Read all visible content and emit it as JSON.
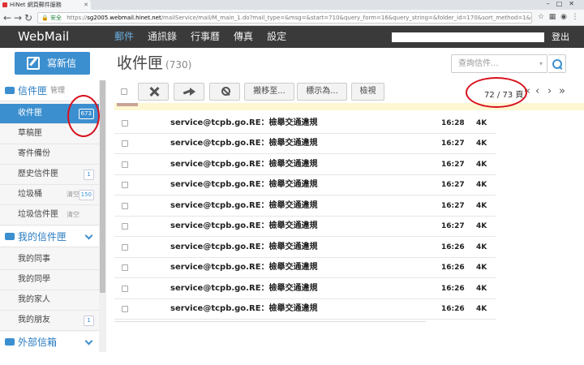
{
  "browser": {
    "tab_title": "HiNet 網頁郵件服務",
    "security_label": "安全",
    "url_scheme": "https://",
    "url_domain": "sg2005.webmail.hinet.net",
    "url_path": "/mailService/mail/M_main_1.do?mail_type=&msg=&start=710&query_form=16&query_string=&folder_id=170&sort_method=1&sort..."
  },
  "header": {
    "logo": "WebMail",
    "nav": [
      "郵件",
      "通訊錄",
      "行事曆",
      "傳真",
      "設定"
    ],
    "active_nav": "郵件",
    "logout": "登出"
  },
  "compose": {
    "label": "寫新信"
  },
  "main": {
    "title": "收件匣",
    "count": "(730)",
    "search_placeholder": "查詢信件..."
  },
  "sidebar": {
    "sections": [
      {
        "title": "信件匣",
        "sub": "管理"
      },
      {
        "title": "我的信件匣"
      },
      {
        "title": "外部信箱"
      }
    ],
    "folders": [
      {
        "label": "收件匣",
        "badge": "673",
        "active": true
      },
      {
        "label": "草稿匣"
      },
      {
        "label": "寄件備份"
      },
      {
        "label": "歷史信件匣",
        "badge": "1"
      },
      {
        "label": "垃圾桶",
        "empty": "清空",
        "badge": "150"
      },
      {
        "label": "垃圾信件匣",
        "empty": "清空"
      }
    ],
    "my_folders": [
      {
        "label": "我的同事"
      },
      {
        "label": "我的同學"
      },
      {
        "label": "我的家人"
      },
      {
        "label": "我的朋友",
        "badge": "1"
      }
    ]
  },
  "toolbar": {
    "move_to": "搬移至...",
    "mark_as": "標示為...",
    "view": "檢視",
    "page_info": "72 / 73 頁"
  },
  "messages": [
    {
      "from": "service@tcpb.go...",
      "subject": "RE：檢舉交通違規",
      "time": "16:28",
      "size": "4K"
    },
    {
      "from": "service@tcpb.go...",
      "subject": "RE：檢舉交通違規",
      "time": "16:27",
      "size": "4K"
    },
    {
      "from": "service@tcpb.go...",
      "subject": "RE：檢舉交通違規",
      "time": "16:27",
      "size": "4K"
    },
    {
      "from": "service@tcpb.go...",
      "subject": "RE：檢舉交通違規",
      "time": "16:27",
      "size": "4K"
    },
    {
      "from": "service@tcpb.go...",
      "subject": "RE：檢舉交通違規",
      "time": "16:27",
      "size": "4K"
    },
    {
      "from": "service@tcpb.go...",
      "subject": "RE：檢舉交通違規",
      "time": "16:27",
      "size": "4K"
    },
    {
      "from": "service@tcpb.go...",
      "subject": "RE：檢舉交通違規",
      "time": "16:26",
      "size": "4K"
    },
    {
      "from": "service@tcpb.go...",
      "subject": "RE：檢舉交通違規",
      "time": "16:26",
      "size": "4K"
    },
    {
      "from": "service@tcpb.go...",
      "subject": "RE：檢舉交通違規",
      "time": "16:26",
      "size": "4K"
    },
    {
      "from": "service@tcpb.go...",
      "subject": "RE：檢舉交通違規",
      "time": "16:26",
      "size": "4K"
    }
  ],
  "icons": {
    "compose": "compose-icon",
    "delete": "close-icon",
    "forward": "forward-icon",
    "spam": "block-icon",
    "search": "search-icon"
  },
  "colors": {
    "accent": "#3c8fcf",
    "appbar": "#3a3a3a",
    "annotation": "#d8101c"
  }
}
